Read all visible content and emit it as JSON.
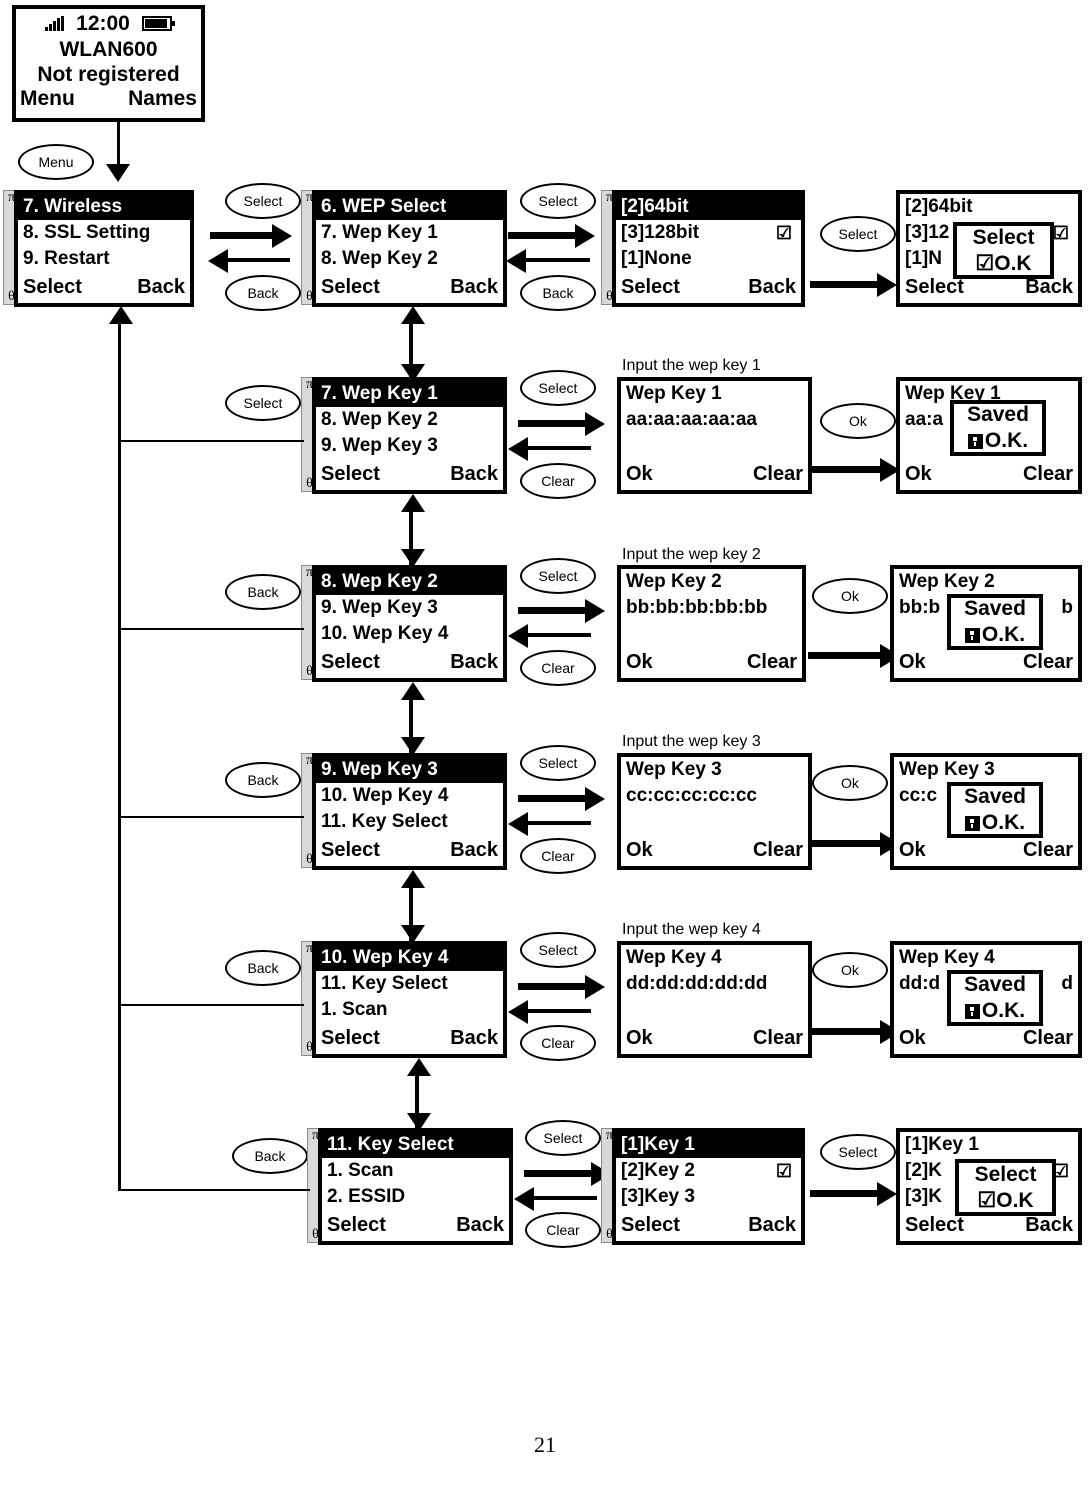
{
  "page": {
    "number": "21"
  },
  "idle_screen": {
    "name": "idle-screen",
    "time": "12:00",
    "title": "WLAN600",
    "status": "Not registered",
    "left_soft": "Menu",
    "right_soft": "Names",
    "icons": {
      "signal": "signal-bars-icon",
      "battery": "battery-full-icon"
    }
  },
  "keys": {
    "menu": "Menu",
    "select": "Select",
    "back": "Back",
    "clear": "Clear",
    "ok": "Ok"
  },
  "softkeys": {
    "select": "Select",
    "back": "Back",
    "ok": "Ok",
    "clear": "Clear"
  },
  "captions": {
    "wep_key_1": "Input the wep key 1",
    "wep_key_2": "Input the wep key 2",
    "wep_key_3": "Input the wep key 3",
    "wep_key_4": "Input the wep key 4"
  },
  "popups": {
    "select_ok": {
      "line1": "Select",
      "line2": "O.K",
      "icon": "checkbox-checked-icon"
    },
    "saved_ok": {
      "line1": "Saved",
      "line2": "O.K.",
      "icon": "saved-block-icon"
    }
  },
  "screens": {
    "wireless_menu": {
      "name": "wireless-menu-screen",
      "rows": [
        "7. Wireless",
        "8. SSL Setting",
        "9. Restart"
      ],
      "scroll": {
        "up": "π",
        "down": "θ"
      }
    },
    "wep_select_menu": {
      "name": "wep-select-menu-screen",
      "rows": [
        "6. WEP Select",
        "7. Wep Key 1",
        "8. Wep Key 2"
      ],
      "scroll": {
        "up": "π",
        "down": "θ"
      }
    },
    "wep_bit_list": {
      "name": "wep-bit-list-screen",
      "rows": [
        "[2]64bit",
        "[3]128bit",
        "[1]None"
      ],
      "checked_row": 1,
      "check_glyph": "☑",
      "scroll": {
        "up": "π",
        "down": "θ"
      }
    },
    "wep_bit_list_confirm": {
      "name": "wep-bit-list-confirm-screen",
      "rows": [
        "[2]64bit",
        "[3]12",
        "[1]N"
      ],
      "check_glyph": "☑"
    },
    "wep_key1_menu": {
      "name": "wep-key-1-menu-screen",
      "rows": [
        "7. Wep Key 1",
        "8. Wep Key 2",
        "9. Wep Key 3"
      ],
      "scroll": {
        "up": "π",
        "down": "θ"
      }
    },
    "wep_key2_menu": {
      "name": "wep-key-2-menu-screen",
      "rows": [
        "8. Wep Key 2",
        "9. Wep Key 3",
        "10. Wep Key 4"
      ],
      "scroll": {
        "up": "π",
        "down": "θ"
      }
    },
    "wep_key3_menu": {
      "name": "wep-key-3-menu-screen",
      "rows": [
        "9. Wep Key 3",
        "10. Wep Key 4",
        "11. Key Select"
      ],
      "scroll": {
        "up": "π",
        "down": "θ"
      }
    },
    "wep_key4_menu": {
      "name": "wep-key-4-menu-screen",
      "rows": [
        "10. Wep Key 4",
        "11. Key Select",
        "1. Scan"
      ],
      "scroll": {
        "up": "π",
        "down": "θ"
      }
    },
    "key_select_menu": {
      "name": "key-select-menu-screen",
      "rows": [
        "11. Key Select",
        "1. Scan",
        "2. ESSID"
      ],
      "scroll": {
        "up": "π",
        "down": "θ"
      }
    },
    "key_list": {
      "name": "key-list-screen",
      "rows": [
        "[1]Key 1",
        "[2]Key 2",
        "[3]Key 3"
      ],
      "checked_row": 1,
      "check_glyph": "☑",
      "scroll": {
        "up": "π",
        "down": "θ"
      }
    },
    "key_list_confirm": {
      "name": "key-list-confirm-screen",
      "rows": [
        "[1]Key 1",
        "[2]K",
        "[3]K"
      ],
      "check_glyph": "☑"
    },
    "wep_key1_input": {
      "name": "wep-key-1-input-screen",
      "title": "Wep Key 1",
      "value": "aa:aa:aa:aa:aa"
    },
    "wep_key1_saved": {
      "name": "wep-key-1-saved-screen",
      "title": "Wep Key 1",
      "value": "aa:a"
    },
    "wep_key2_input": {
      "name": "wep-key-2-input-screen",
      "title": "Wep Key 2",
      "value": "bb:bb:bb:bb:bb"
    },
    "wep_key2_saved": {
      "name": "wep-key-2-saved-screen",
      "title": "Wep Key 2",
      "value": "bb:b",
      "value_tail": "b"
    },
    "wep_key3_input": {
      "name": "wep-key-3-input-screen",
      "title": "Wep Key 3",
      "value": "cc:cc:cc:cc:cc"
    },
    "wep_key3_saved": {
      "name": "wep-key-3-saved-screen",
      "title": "Wep Key 3",
      "value": "cc:c"
    },
    "wep_key4_input": {
      "name": "wep-key-4-input-screen",
      "title": "Wep Key 4",
      "value": "dd:dd:dd:dd:dd"
    },
    "wep_key4_saved": {
      "name": "wep-key-4-saved-screen",
      "title": "Wep Key 4",
      "value": "dd:d",
      "value_tail": "d"
    }
  }
}
